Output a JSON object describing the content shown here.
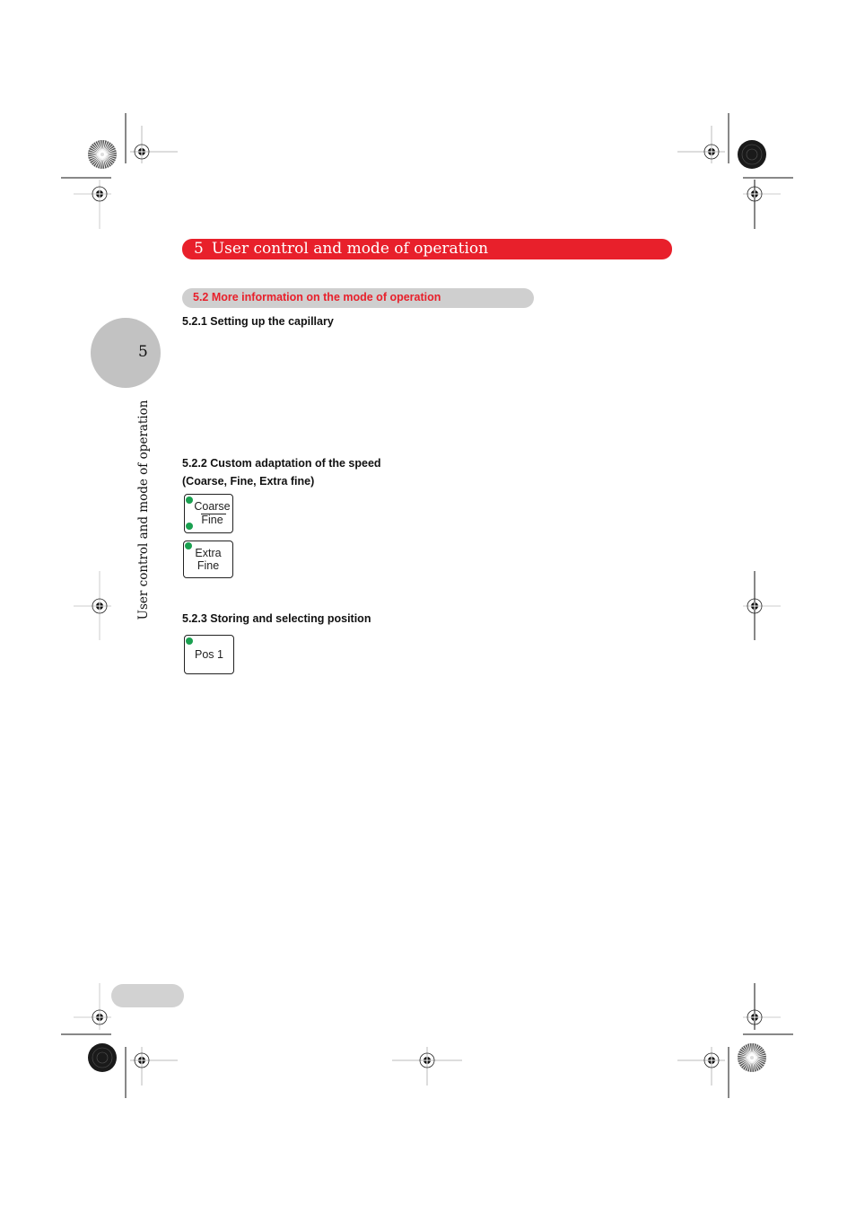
{
  "chapter": {
    "number": "5",
    "title": "User control and mode of operation"
  },
  "side_tab": {
    "number": "5",
    "label": "User control and mode of operation"
  },
  "section": {
    "title": "5.2  More information on the mode of operation"
  },
  "subsections": [
    {
      "title": "5.2.1  Setting up the capillary"
    },
    {
      "title": "5.2.2  Custom adaptation of the speed",
      "subtitle": "(Coarse, Fine, Extra fine)"
    },
    {
      "title": "5.2.3  Storing and selecting position"
    }
  ],
  "keys": {
    "coarse_fine": {
      "top": "Coarse",
      "bottom": "Fine"
    },
    "extra_fine": {
      "line1": "Extra",
      "line2": "Fine"
    },
    "pos1": {
      "label": "Pos 1"
    }
  },
  "colors": {
    "accent_red": "#e8202b",
    "section_grey": "#cfcfcf",
    "led_green": "#1aa050"
  }
}
